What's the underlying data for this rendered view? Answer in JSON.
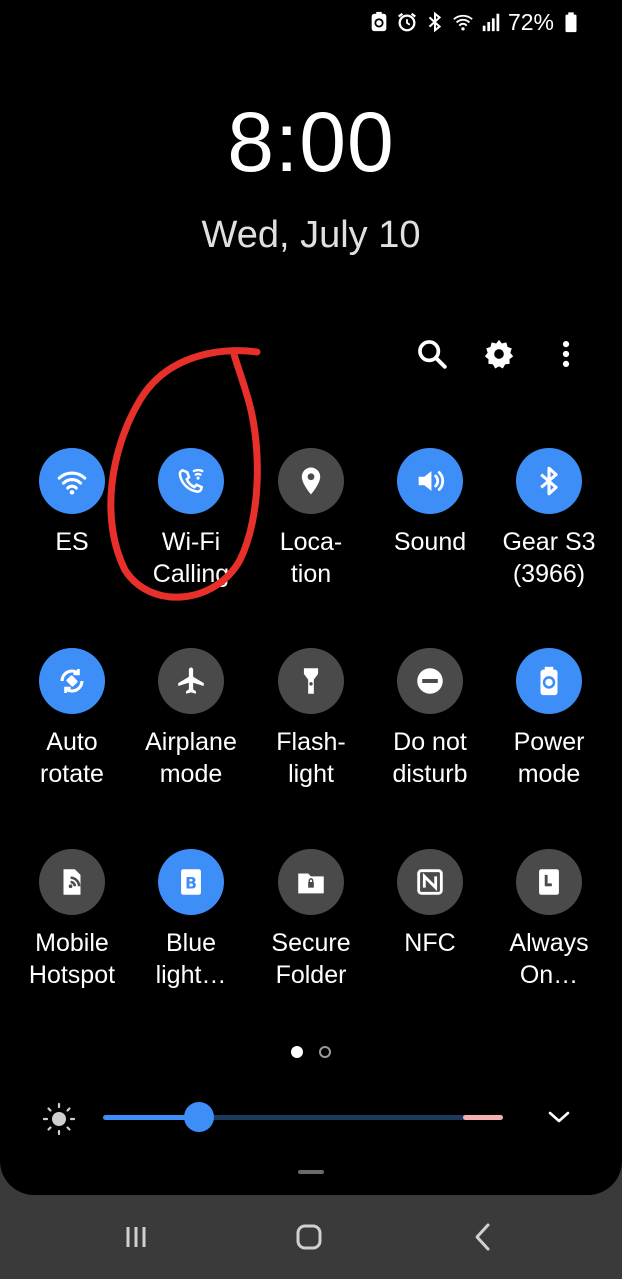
{
  "status": {
    "battery_percent": "72%",
    "icons": [
      "battery-saver-icon",
      "alarm-icon",
      "bluetooth-icon",
      "wifi-icon",
      "signal-icon",
      "battery-icon"
    ]
  },
  "clock": {
    "time": "8:00",
    "date": "Wed, July 10"
  },
  "toolbar": {
    "icons": [
      "search-icon",
      "gear-icon",
      "more-vert-icon"
    ]
  },
  "tiles": [
    {
      "label": "ES",
      "icon": "wifi-icon",
      "state": "on"
    },
    {
      "label": "Wi-Fi\nCalling",
      "icon": "wifi-calling-icon",
      "state": "on"
    },
    {
      "label": "Loca-\ntion",
      "icon": "location-pin-icon",
      "state": "off"
    },
    {
      "label": "Sound",
      "icon": "speaker-icon",
      "state": "on"
    },
    {
      "label": "Gear S3\n(3966)",
      "icon": "bluetooth-icon",
      "state": "on"
    },
    {
      "label": "Auto\nrotate",
      "icon": "auto-rotate-icon",
      "state": "on"
    },
    {
      "label": "Airplane\nmode",
      "icon": "airplane-icon",
      "state": "off"
    },
    {
      "label": "Flash-\nlight",
      "icon": "flashlight-icon",
      "state": "off"
    },
    {
      "label": "Do not\ndisturb",
      "icon": "do-not-disturb-icon",
      "state": "off"
    },
    {
      "label": "Power\nmode",
      "icon": "power-mode-icon",
      "state": "on"
    },
    {
      "label": "Mobile\nHotspot",
      "icon": "hotspot-icon",
      "state": "off"
    },
    {
      "label": "Blue\nlight…",
      "icon": "blue-light-filter-icon",
      "state": "on"
    },
    {
      "label": "Secure\nFolder",
      "icon": "secure-folder-icon",
      "state": "off"
    },
    {
      "label": "NFC",
      "icon": "nfc-icon",
      "state": "off"
    },
    {
      "label": "Always\nOn…",
      "icon": "always-on-display-icon",
      "state": "off"
    }
  ],
  "pagination": {
    "current": 1,
    "total": 2
  },
  "brightness": {
    "level": 0.24
  },
  "nav": {
    "buttons": [
      "recent-apps-icon",
      "home-icon",
      "back-icon"
    ]
  },
  "colors": {
    "accent": "#3e8ef7",
    "tile_off": "#4a4a4a",
    "annotation": "#e8302b"
  }
}
